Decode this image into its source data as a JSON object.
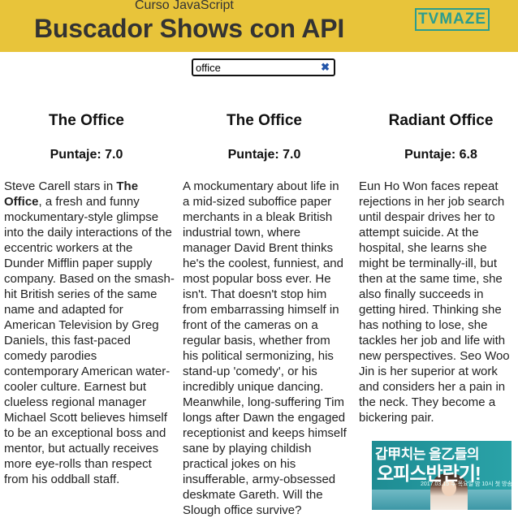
{
  "header": {
    "subtitle": "Curso JavaScript",
    "title": "Buscador Shows con API",
    "logo_text": "TVMAZE",
    "background_color": "#e8c43a",
    "logo_color": "#2a9d8f"
  },
  "search": {
    "value": "office",
    "clear_glyph": "✖"
  },
  "shows": [
    {
      "name": "The Office",
      "rating_label": "Puntaje: 7.0",
      "summary_before": "Steve Carell stars in ",
      "summary_bold": "The Office",
      "summary_after": ", a fresh and funny mockumentary-style glimpse into the daily interactions of the eccentric workers at the Dunder Mifflin paper supply company. Based on the smash-hit British series of the same name and adapted for American Television by Greg Daniels, this fast-paced comedy parodies contemporary American water-cooler culture. Earnest but clueless regional manager Michael Scott believes himself to be an exceptional boss and mentor, but actually receives more eye-rolls than respect from his oddball staff."
    },
    {
      "name": "The Office",
      "rating_label": "Puntaje: 7.0",
      "summary": "A mockumentary about life in a mid-sized suboffice paper merchants in a bleak British industrial town, where manager David Brent thinks he's the coolest, funniest, and most popular boss ever. He isn't. That doesn't stop him from embarrassing himself in front of the cameras on a regular basis, whether from his political sermonizing, his stand-up 'comedy', or his incredibly unique dancing. Meanwhile, long-suffering Tim longs after Dawn the engaged receptionist and keeps himself sane by playing childish practical jokes on his insufferable, army-obsessed deskmate Gareth. Will the Slough office survive?"
    },
    {
      "name": "Radiant Office",
      "rating_label": "Puntaje: 6.8",
      "summary": "Eun Ho Won faces repeat rejections in her job search until despair drives her to attempt suicide. At the hospital, she learns she might be terminally-ill, but then at the same time, she also finally succeeds in getting hired. Thinking she has nothing to lose, she tackles her job and life with new perspectives. Seo Woo Jin is her superior at work and considers her a pain in the neck. They become a bickering pair.",
      "poster": {
        "line1": "갑甲치는 을乙들의",
        "line2": "오피스반란기!",
        "date_line": "2017.03.15 수·목요일 밤 10시 첫 방송"
      }
    }
  ]
}
